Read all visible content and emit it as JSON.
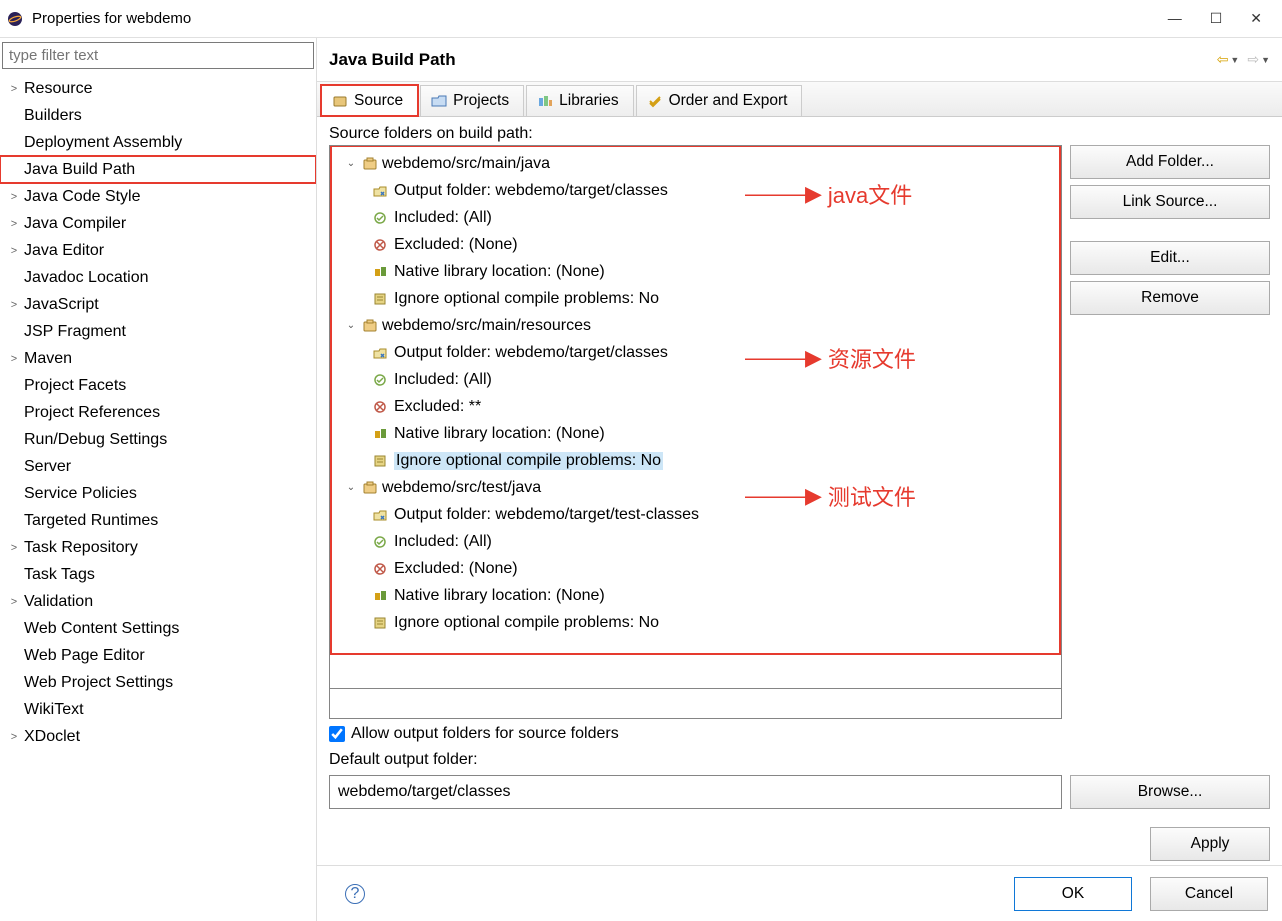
{
  "titlebar": {
    "title": "Properties for webdemo"
  },
  "filter_placeholder": "type filter text",
  "sidebar": [
    {
      "label": "Resource",
      "chev": true
    },
    {
      "label": "Builders",
      "chev": false
    },
    {
      "label": "Deployment Assembly",
      "chev": false
    },
    {
      "label": "Java Build Path",
      "chev": false,
      "highlight": true
    },
    {
      "label": "Java Code Style",
      "chev": true
    },
    {
      "label": "Java Compiler",
      "chev": true
    },
    {
      "label": "Java Editor",
      "chev": true
    },
    {
      "label": "Javadoc Location",
      "chev": false
    },
    {
      "label": "JavaScript",
      "chev": true
    },
    {
      "label": "JSP Fragment",
      "chev": false
    },
    {
      "label": "Maven",
      "chev": true
    },
    {
      "label": "Project Facets",
      "chev": false
    },
    {
      "label": "Project References",
      "chev": false
    },
    {
      "label": "Run/Debug Settings",
      "chev": false
    },
    {
      "label": "Server",
      "chev": false
    },
    {
      "label": "Service Policies",
      "chev": false
    },
    {
      "label": "Targeted Runtimes",
      "chev": false
    },
    {
      "label": "Task Repository",
      "chev": true
    },
    {
      "label": "Task Tags",
      "chev": false
    },
    {
      "label": "Validation",
      "chev": true
    },
    {
      "label": "Web Content Settings",
      "chev": false
    },
    {
      "label": "Web Page Editor",
      "chev": false
    },
    {
      "label": "Web Project Settings",
      "chev": false
    },
    {
      "label": "WikiText",
      "chev": false
    },
    {
      "label": "XDoclet",
      "chev": true
    }
  ],
  "header_title": "Java Build Path",
  "tabs": [
    {
      "label": "Source",
      "active": true
    },
    {
      "label": "Projects",
      "active": false
    },
    {
      "label": "Libraries",
      "active": false
    },
    {
      "label": "Order and Export",
      "active": false
    }
  ],
  "source_folders_label": "Source folders on build path:",
  "folders": [
    {
      "name": "webdemo/src/main/java",
      "anno": "java文件",
      "items": [
        {
          "label": "Output folder: webdemo/target/classes"
        },
        {
          "label": "Included: (All)"
        },
        {
          "label": "Excluded: (None)"
        },
        {
          "label": "Native library location: (None)"
        },
        {
          "label": "Ignore optional compile problems: No"
        }
      ]
    },
    {
      "name": "webdemo/src/main/resources",
      "anno": "资源文件",
      "items": [
        {
          "label": "Output folder: webdemo/target/classes"
        },
        {
          "label": "Included: (All)"
        },
        {
          "label": "Excluded: **"
        },
        {
          "label": "Native library location: (None)"
        },
        {
          "label": "Ignore optional compile problems: No",
          "sel": true
        }
      ]
    },
    {
      "name": "webdemo/src/test/java",
      "anno": "测试文件",
      "name_sel": true,
      "items": [
        {
          "label": "Output folder: webdemo/target/test-classes"
        },
        {
          "label": "Included: (All)"
        },
        {
          "label": "Excluded: (None)"
        },
        {
          "label": "Native library location: (None)"
        },
        {
          "label": "Ignore optional compile problems: No"
        }
      ]
    }
  ],
  "buttons": {
    "add_folder": "Add Folder...",
    "link_source": "Link Source...",
    "edit": "Edit...",
    "remove": "Remove",
    "browse": "Browse...",
    "apply": "Apply",
    "ok": "OK",
    "cancel": "Cancel"
  },
  "allow_output_label": "Allow output folders for source folders",
  "allow_output_checked": true,
  "default_output_label": "Default output folder:",
  "default_output_value": "webdemo/target/classes"
}
